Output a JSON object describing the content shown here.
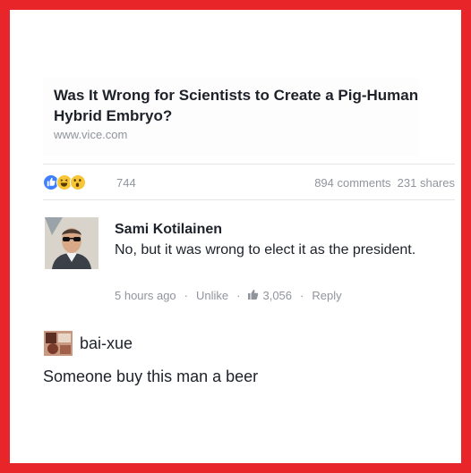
{
  "post": {
    "link_title": "Was It Wrong for Scientists to Create a Pig-Human Hybrid Embryo?",
    "link_domain": "www.vice.com",
    "reaction_icons": [
      "like-icon",
      "haha-icon",
      "wow-icon"
    ],
    "reaction_count": "744",
    "stats": "894 comments  231 shares"
  },
  "comment": {
    "author": "Sami Kotilainen",
    "text": "No, but it was wrong to elect it as the president.",
    "time": "5 hours ago",
    "sep": "·",
    "unlike_label": "Unlike",
    "like_count": "3,056",
    "reply_label": "Reply"
  },
  "reply": {
    "username": "bai-xue",
    "text": "Someone buy this man a beer"
  },
  "colors": {
    "frame": "#e8262a",
    "like_blue": "#4080ff",
    "emoji_yellow": "#f7c637",
    "meta_gray": "#90949c"
  }
}
